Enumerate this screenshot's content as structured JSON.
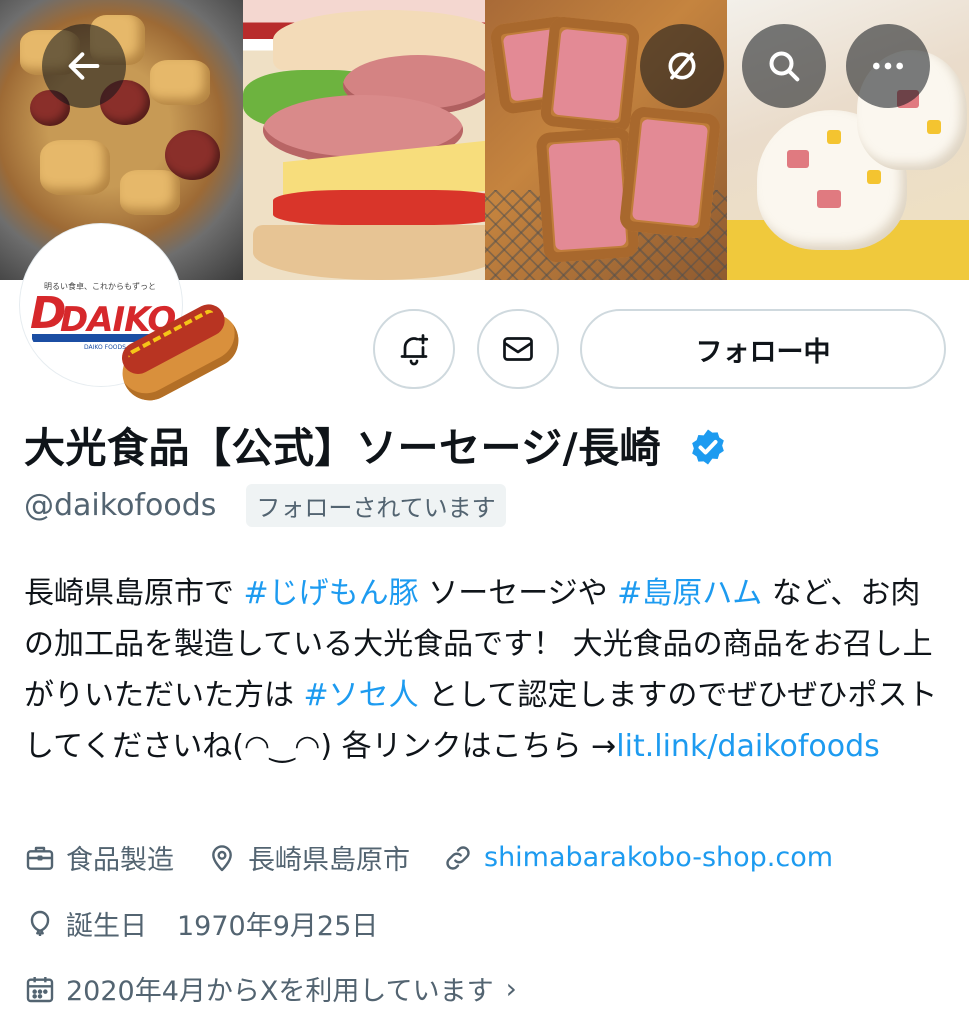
{
  "header": {
    "back_icon": "back-arrow-icon",
    "grok_icon": "grok-slash-icon",
    "search_icon": "search-icon",
    "more_icon": "more-dots-icon"
  },
  "avatar": {
    "tagline": "明るい食卓、これからもずっと",
    "logo_d": "D",
    "logo_text": "DAIKO",
    "logo_subtext": "DAIKO FOODS CO.,LTD."
  },
  "actions": {
    "notify_icon": "bell-plus-icon",
    "message_icon": "mail-icon",
    "follow_label": "フォロー中"
  },
  "profile": {
    "display_name": "大光食品【公式】ソーセージ/長崎",
    "verified": true,
    "handle": "@daikofoods",
    "follows_you_label": "フォローされています"
  },
  "bio": {
    "p1": "長崎県島原市で ",
    "tag1": "#じげもん豚",
    "p2": " ソーセージや ",
    "tag2": "#島原ハム",
    "p3": " など、お肉の加工品を製造している大光食品です！ 大光食品の商品をお召し上がりいただいた方は ",
    "tag3": "#ソセ人",
    "p4": " として認定しますのでぜひぜひポストしてくださいね(◠‿◠) 各リンクはこちら →",
    "link": "lit.link/daikofoods"
  },
  "meta": {
    "category": "食品製造",
    "location": "長崎県島原市",
    "website": "shimabarakobo-shop.com",
    "birthday_label": "誕生日",
    "birthday_date": "1970年9月25日",
    "joined": "2020年4月からXを利用しています",
    "joined_chevron": "›"
  },
  "colors": {
    "accent": "#1d9bf0",
    "text_primary": "#0f1419",
    "text_secondary": "#536471",
    "border": "#cfd9de"
  }
}
